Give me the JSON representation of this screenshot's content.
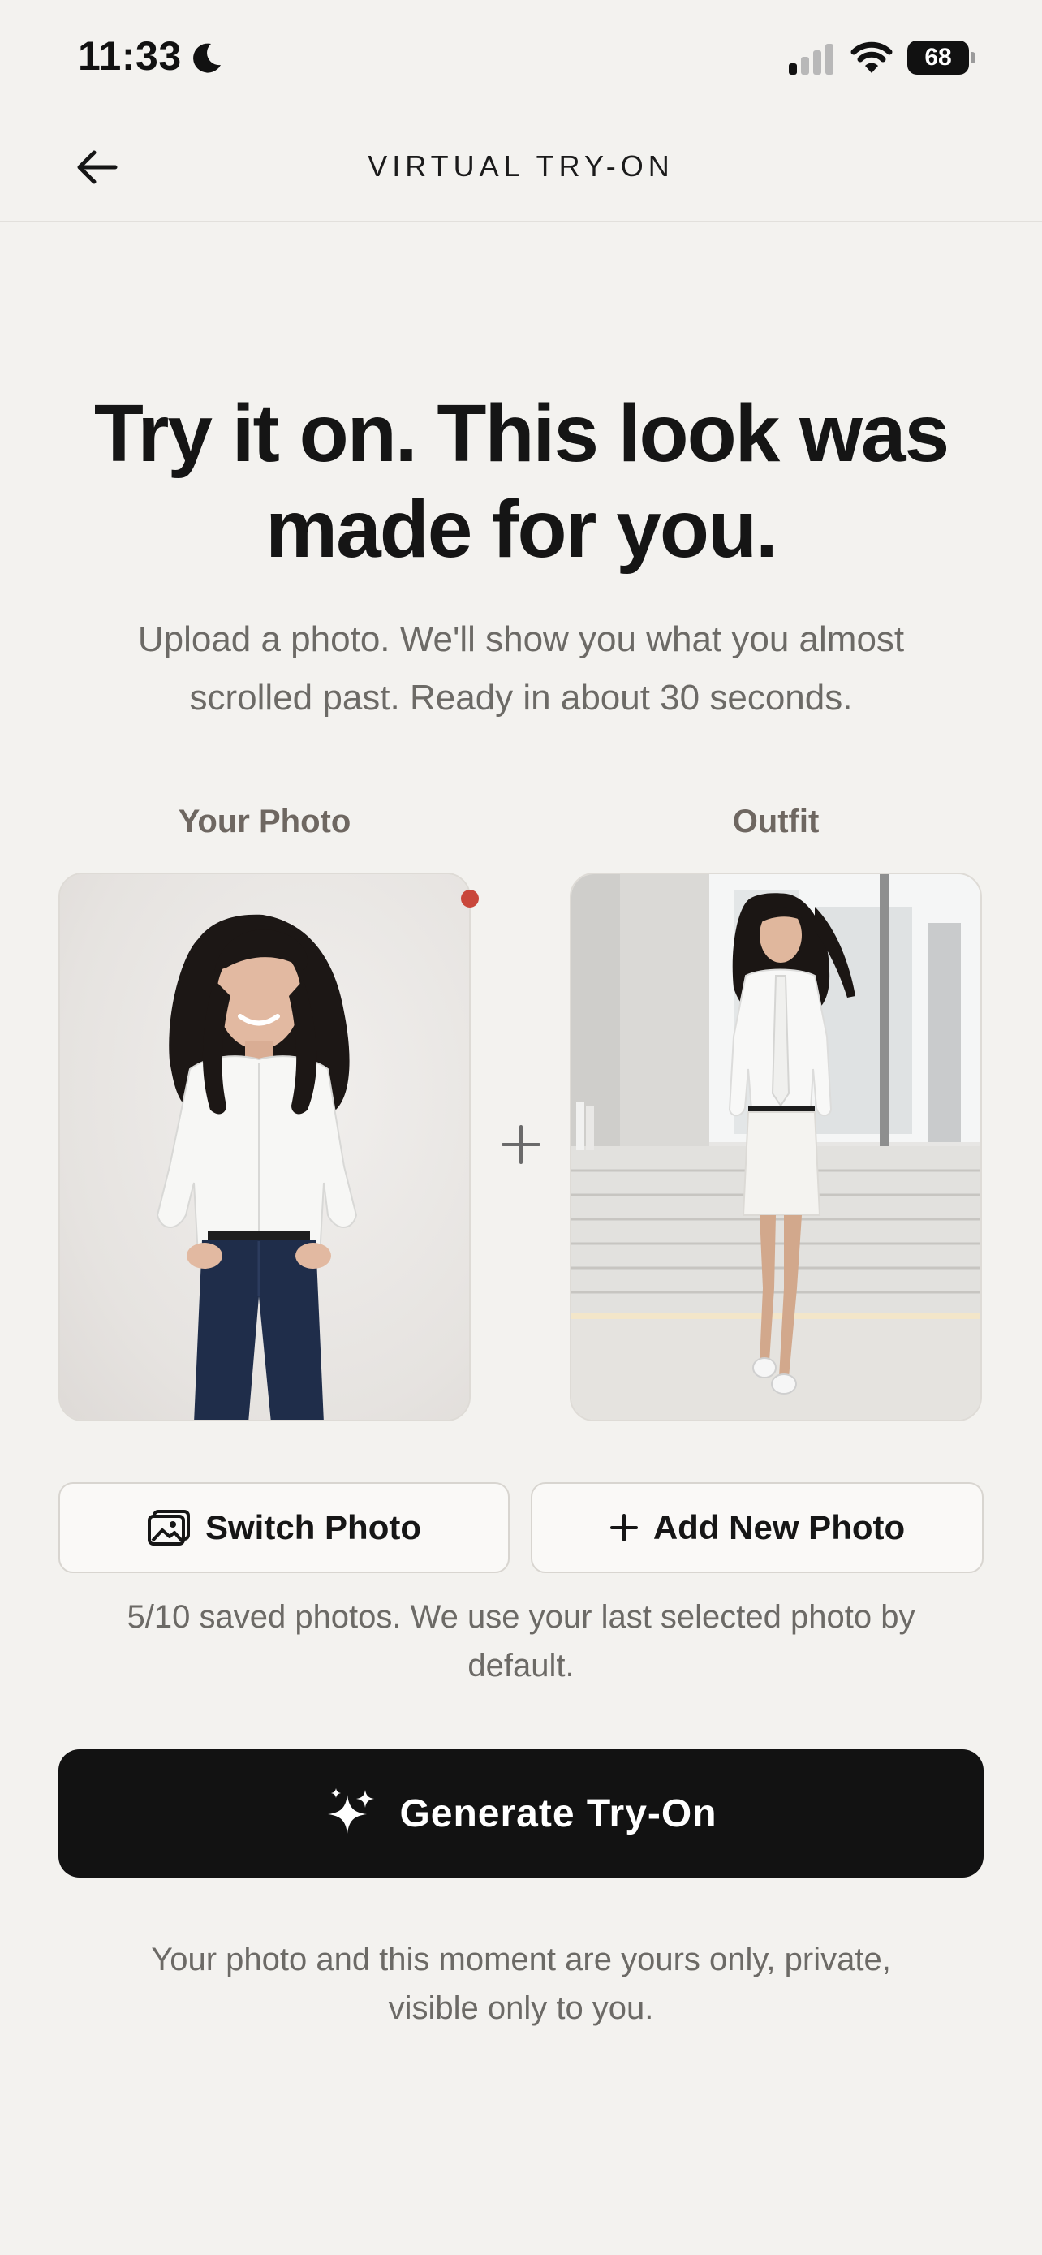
{
  "status_bar": {
    "time": "11:33",
    "battery": "68"
  },
  "nav": {
    "title": "VIRTUAL TRY-ON"
  },
  "hero": {
    "title_line1": "Try it on. This look was",
    "title_line2": "made for you.",
    "subtitle_line1": "Upload a photo. We'll show you what you almost",
    "subtitle_line2": "scrolled past. Ready in about 30 seconds."
  },
  "photos": {
    "your_label": "Your Photo",
    "outfit_label": "Outfit"
  },
  "actions": {
    "switch_label": "Switch Photo",
    "add_label": "Add New Photo"
  },
  "saved_note_line1": "5/10 saved photos. We use your last selected photo by",
  "saved_note_line2": "default.",
  "generate_label": "Generate Try-On",
  "privacy_line1": "Your photo and this moment are yours only, private,",
  "privacy_line2": "visible only to you.",
  "icons": {
    "back": "arrow-left-icon",
    "moon": "moon-icon",
    "signal": "cellular-signal-icon",
    "wifi": "wifi-icon",
    "battery": "battery-icon",
    "plus": "plus-icon",
    "image": "image-icon",
    "sparkle": "sparkle-icon"
  },
  "colors": {
    "background": "#f3f2ef",
    "primary_button": "#121212",
    "muted_text": "#6c6a66",
    "selected_dot": "#c9473b"
  }
}
